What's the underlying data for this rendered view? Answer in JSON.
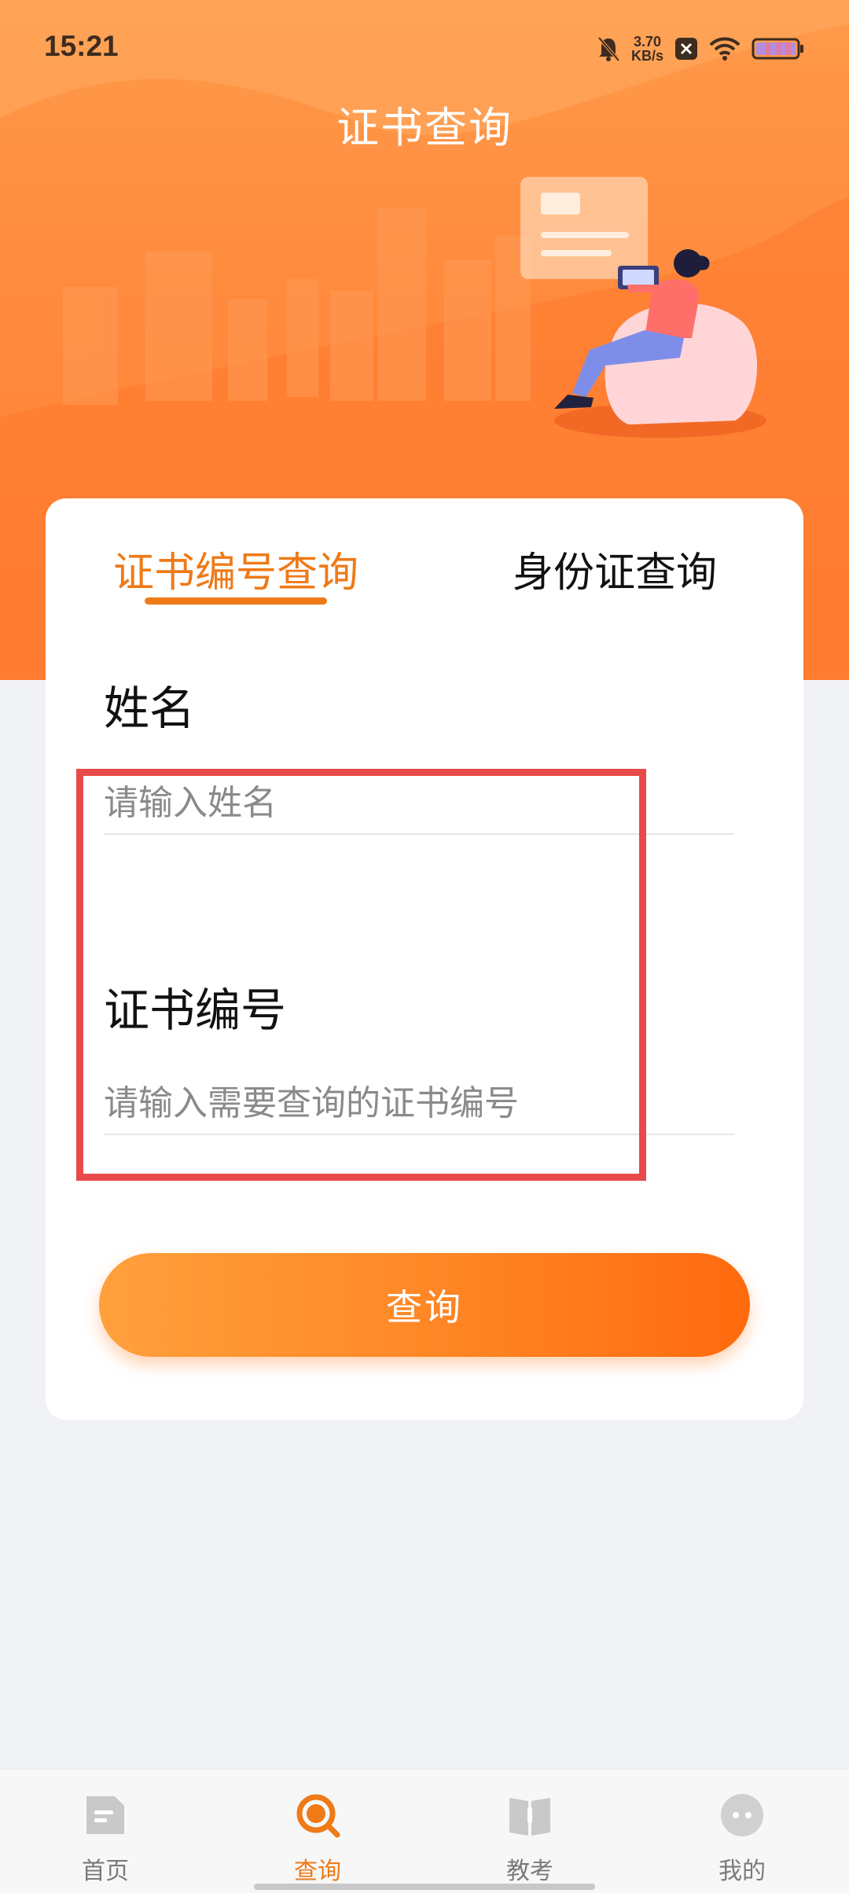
{
  "status_bar": {
    "time": "15:21",
    "net_speed_value": "3.70",
    "net_speed_unit": "KB/s",
    "icons": [
      "bell-off-icon",
      "close-badge-icon",
      "wifi-icon",
      "battery-icon"
    ]
  },
  "header": {
    "title": "证书查询"
  },
  "tabs": [
    {
      "label": "证书编号查询",
      "active": true
    },
    {
      "label": "身份证查询",
      "active": false
    }
  ],
  "form": {
    "name_label": "姓名",
    "name_placeholder": "请输入姓名",
    "cert_label": "证书编号",
    "cert_placeholder": "请输入需要查询的证书编号",
    "submit_label": "查询"
  },
  "bottom_nav": [
    {
      "label": "首页",
      "icon": "home-doc-icon",
      "active": false
    },
    {
      "label": "查询",
      "icon": "search-icon",
      "active": true
    },
    {
      "label": "教考",
      "icon": "book-icon",
      "active": false
    },
    {
      "label": "我的",
      "icon": "profile-icon",
      "active": false
    }
  ],
  "colors": {
    "accent": "#ee7a18",
    "hero": "#ff8a3d",
    "highlight": "#e84a4a",
    "page_bg": "#f0f2f5"
  }
}
